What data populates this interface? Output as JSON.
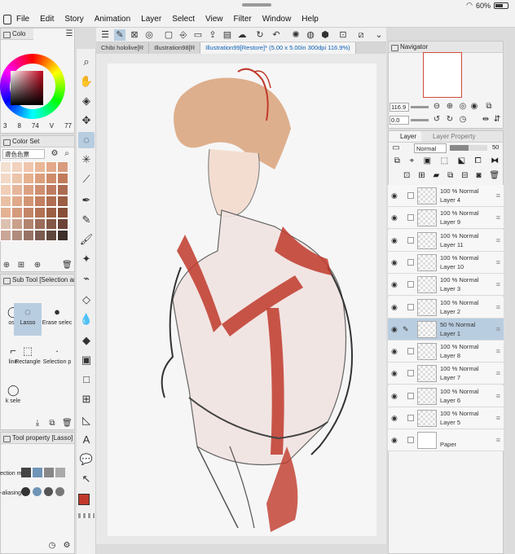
{
  "status": {
    "battery": "60%"
  },
  "menu": [
    "File",
    "Edit",
    "Story",
    "Animation",
    "Layer",
    "Select",
    "View",
    "Filter",
    "Window",
    "Help"
  ],
  "color_panel": {
    "tab_label": "Colo",
    "values": [
      "3",
      "8",
      "74",
      "V",
      "77"
    ]
  },
  "color_set": {
    "title": "Color Set",
    "set_name": "膚色色票",
    "swatches": [
      "#f2e0d0",
      "#f1d2bf",
      "#efc6ad",
      "#e8b797",
      "#e3a98a",
      "#d99b7d",
      "#f3d8c6",
      "#ecc4aa",
      "#e5b18f",
      "#dc9f7d",
      "#cf8d6c",
      "#c17b5c",
      "#f0cdb6",
      "#e6b69a",
      "#dca183",
      "#d08e71",
      "#c07c63",
      "#ad6b53",
      "#e9c0a4",
      "#dfa98a",
      "#d39574",
      "#c48060",
      "#b06e51",
      "#9b5d44",
      "#e3b293",
      "#d49a7c",
      "#c48567",
      "#b27253",
      "#9c6045",
      "#874f37",
      "#dcc0b0",
      "#c9a08c",
      "#b28470",
      "#9c6c5a",
      "#845746",
      "#6c4436",
      "#c9a697",
      "#b08c7d",
      "#967364",
      "#7a5b4f",
      "#5e463d",
      "#3d2f2a"
    ]
  },
  "subtool": {
    "title": "Sub Tool [Selection area]",
    "tools": [
      {
        "label": "ose",
        "icon": "◯"
      },
      {
        "label": "Lasso",
        "icon": "◌"
      },
      {
        "label": "Erase selec",
        "icon": "●"
      },
      {
        "label": "line",
        "icon": "⌐"
      },
      {
        "label": "Rectangle",
        "icon": "⬚"
      },
      {
        "label": "Selection p",
        "icon": "·"
      },
      {
        "label": "k sele",
        "icon": "◯"
      }
    ]
  },
  "tool_property": {
    "title": "Tool property [Lasso]",
    "rows": [
      "ection m",
      "-aliasing"
    ]
  },
  "tabs": [
    {
      "label": "Chibi hololive[R",
      "active": false
    },
    {
      "label": "Illustration98[R",
      "active": false
    },
    {
      "label": "Illustration99[Restore]* (5.00 x 5.00in 300dpi 116.9%)",
      "active": true
    }
  ],
  "navigator": {
    "title": "Navigator",
    "zoom": "116.9",
    "angle": "0.0"
  },
  "layer_panel": {
    "tabs": [
      "Layer",
      "Layer Property"
    ],
    "blend_mode": "Normal",
    "opacity": "50",
    "layers": [
      {
        "opacity": "100 %",
        "mode": "Normal",
        "name": "Layer 4",
        "selected": false,
        "paper": false
      },
      {
        "opacity": "100 %",
        "mode": "Normal",
        "name": "Layer 9",
        "selected": false,
        "paper": false
      },
      {
        "opacity": "100 %",
        "mode": "Normal",
        "name": "Layer 11",
        "selected": false,
        "paper": false
      },
      {
        "opacity": "100 %",
        "mode": "Normal",
        "name": "Layer 10",
        "selected": false,
        "paper": false
      },
      {
        "opacity": "100 %",
        "mode": "Normal",
        "name": "Layer 3",
        "selected": false,
        "paper": false
      },
      {
        "opacity": "100 %",
        "mode": "Normal",
        "name": "Layer 2",
        "selected": false,
        "paper": false
      },
      {
        "opacity": "50 %",
        "mode": "Normal",
        "name": "Layer 1",
        "selected": true,
        "paper": false
      },
      {
        "opacity": "100 %",
        "mode": "Normal",
        "name": "Layer 8",
        "selected": false,
        "paper": false
      },
      {
        "opacity": "100 %",
        "mode": "Normal",
        "name": "Layer 7",
        "selected": false,
        "paper": false
      },
      {
        "opacity": "100 %",
        "mode": "Normal",
        "name": "Layer 6",
        "selected": false,
        "paper": false
      },
      {
        "opacity": "100 %",
        "mode": "Normal",
        "name": "Layer 5",
        "selected": false,
        "paper": false
      },
      {
        "opacity": "",
        "mode": "",
        "name": "Paper",
        "selected": false,
        "paper": true
      }
    ]
  },
  "colors": {
    "main_color": "#c0392b",
    "accent": "#0b5fb3",
    "selection": "#b9cde0"
  }
}
